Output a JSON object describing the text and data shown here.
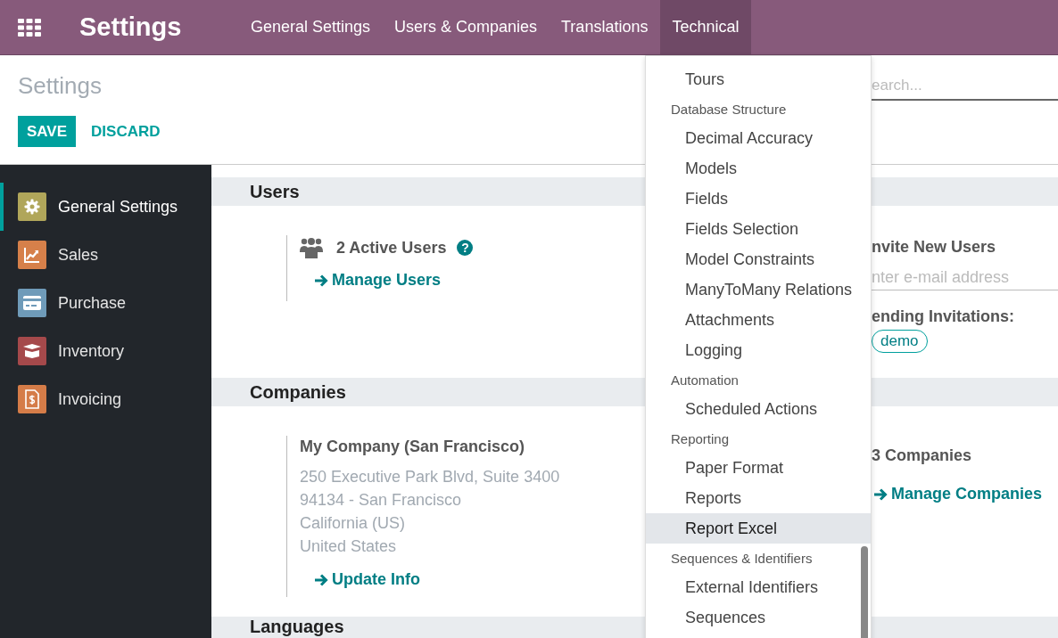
{
  "navbar": {
    "app_title": "Settings",
    "menus": [
      {
        "label": "General Settings",
        "selected": false
      },
      {
        "label": "Users & Companies",
        "selected": false
      },
      {
        "label": "Translations",
        "selected": false
      },
      {
        "label": "Technical",
        "selected": true
      }
    ]
  },
  "control_panel": {
    "title": "Settings",
    "buttons": [
      {
        "label": "SAVE",
        "kind": "primary"
      },
      {
        "label": "DISCARD",
        "kind": "link"
      }
    ],
    "search": {
      "placeholder": "earch..."
    }
  },
  "sidebar": {
    "items": [
      {
        "label": "General Settings",
        "kind": "gear",
        "color": "#b0a65a",
        "selected": true
      },
      {
        "label": "Sales",
        "kind": "chart",
        "color": "#d6804a",
        "selected": false
      },
      {
        "label": "Purchase",
        "kind": "card",
        "color": "#6f9bb9",
        "selected": false
      },
      {
        "label": "Inventory",
        "kind": "box",
        "color": "#a5494b",
        "selected": false
      },
      {
        "label": "Invoicing",
        "kind": "invoice",
        "color": "#d57c48",
        "selected": false
      }
    ]
  },
  "users_section": {
    "title": "Users",
    "active_users": "2 Active Users",
    "help_glyph": "?",
    "manage_link": "Manage Users",
    "invite_title": "nvite New Users",
    "invite_placeholder": "nter e-mail address",
    "pending_label": "ending Invitations:",
    "pending": [
      "demo"
    ]
  },
  "companies_section": {
    "title": "Companies",
    "company_name": "My Company (San Francisco)",
    "address": [
      "250 Executive Park Blvd, Suite 3400",
      "94134 - San Francisco",
      "California (US)",
      "United States"
    ],
    "update_link": "Update Info",
    "count": "3 Companies",
    "manage_link": "Manage Companies"
  },
  "languages_section": {
    "title": "Languages"
  },
  "technical_menu": {
    "entries": [
      {
        "kind": "item",
        "label": "Tours",
        "selected": false
      },
      {
        "kind": "header",
        "label": "Database Structure"
      },
      {
        "kind": "item",
        "label": "Decimal Accuracy",
        "selected": false
      },
      {
        "kind": "item",
        "label": "Models",
        "selected": false
      },
      {
        "kind": "item",
        "label": "Fields",
        "selected": false
      },
      {
        "kind": "item",
        "label": "Fields Selection",
        "selected": false
      },
      {
        "kind": "item",
        "label": "Model Constraints",
        "selected": false
      },
      {
        "kind": "item",
        "label": "ManyToMany Relations",
        "selected": false
      },
      {
        "kind": "item",
        "label": "Attachments",
        "selected": false
      },
      {
        "kind": "item",
        "label": "Logging",
        "selected": false
      },
      {
        "kind": "header",
        "label": "Automation"
      },
      {
        "kind": "item",
        "label": "Scheduled Actions",
        "selected": false
      },
      {
        "kind": "header",
        "label": "Reporting"
      },
      {
        "kind": "item",
        "label": "Paper Format",
        "selected": false
      },
      {
        "kind": "item",
        "label": "Reports",
        "selected": false
      },
      {
        "kind": "item",
        "label": "Report Excel",
        "selected": true
      },
      {
        "kind": "header",
        "label": "Sequences & Identifiers"
      },
      {
        "kind": "item",
        "label": "External Identifiers",
        "selected": false
      },
      {
        "kind": "item",
        "label": "Sequences",
        "selected": false
      }
    ]
  }
}
